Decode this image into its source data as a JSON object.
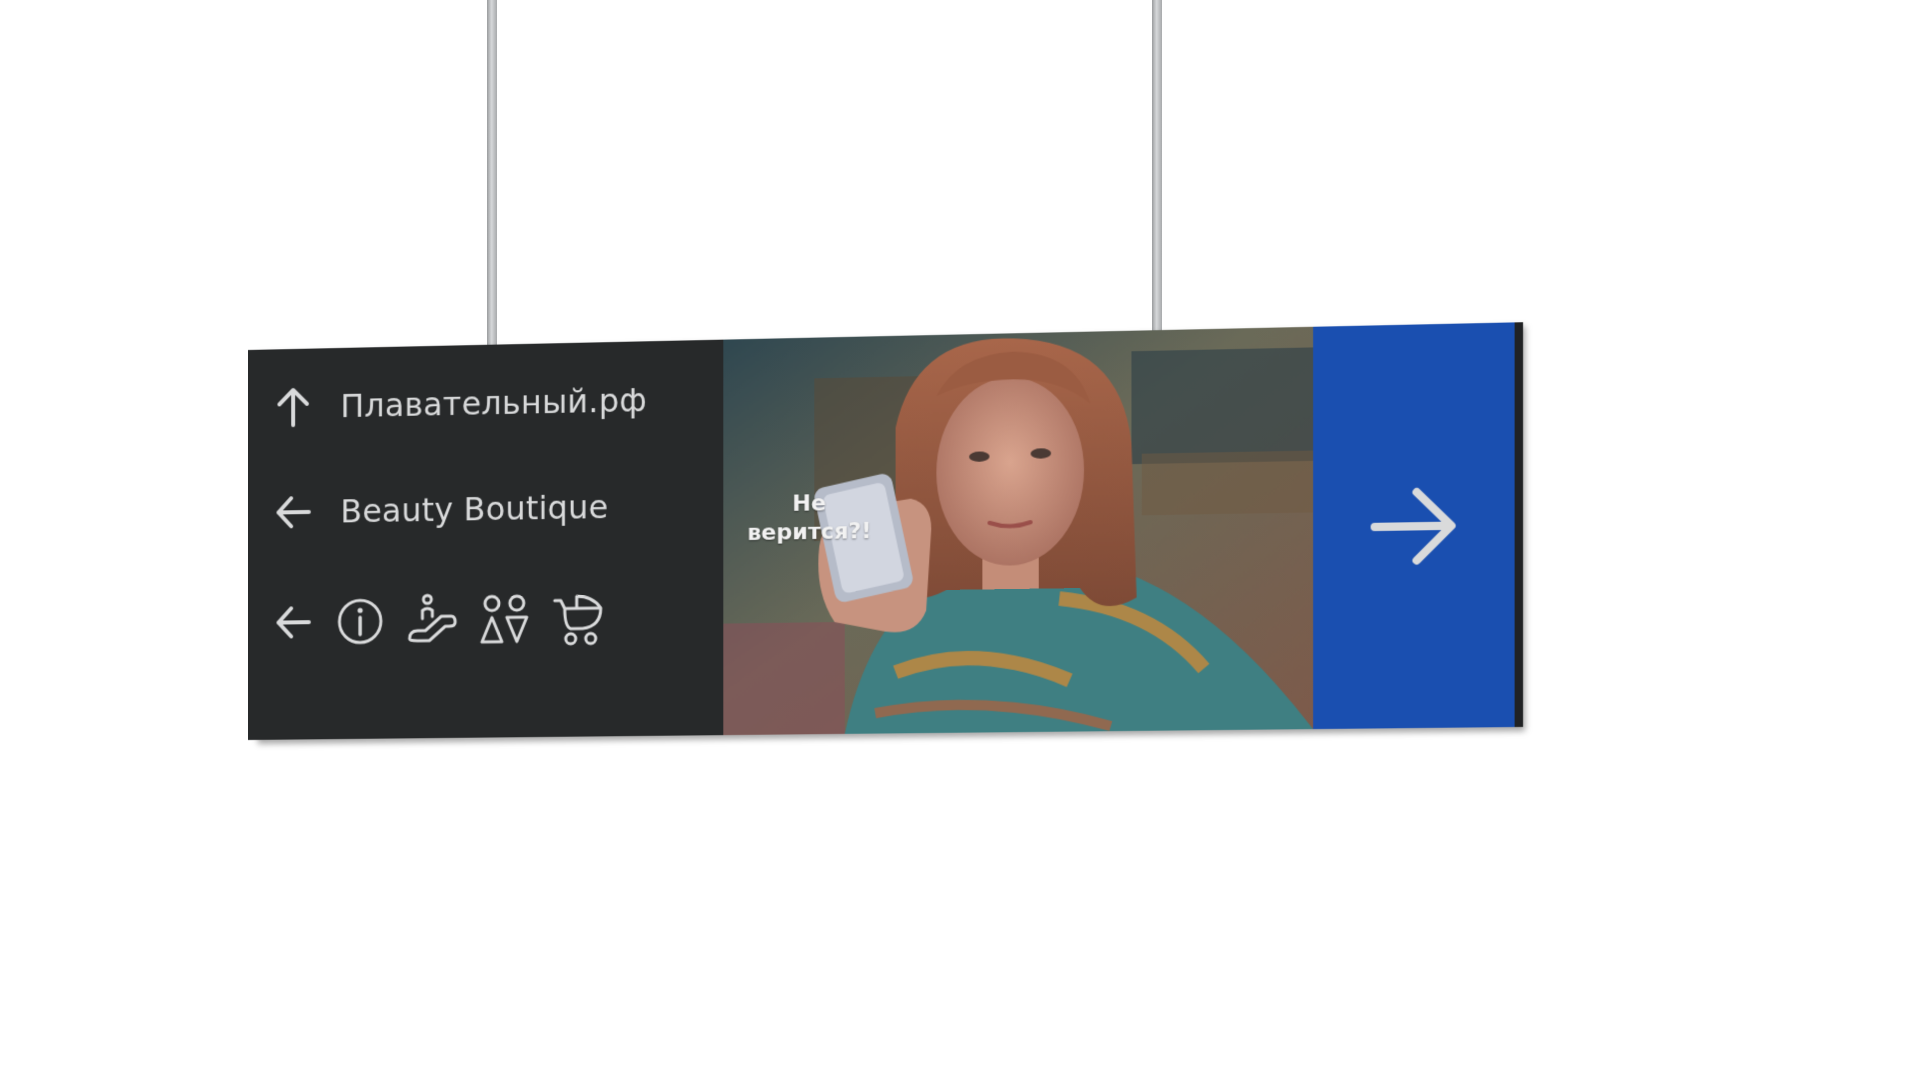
{
  "sign": {
    "rows": [
      {
        "direction": "up",
        "label": "Плавательный.рф"
      },
      {
        "direction": "left",
        "label": "Beauty Boutique"
      },
      {
        "direction": "left",
        "pictograms": [
          "info-icon",
          "escalator-icon",
          "restroom-icon",
          "baby-stroller-icon"
        ]
      }
    ],
    "ad_caption": [
      "Не",
      "верится?!"
    ],
    "right_panel": {
      "direction": "right"
    },
    "colors": {
      "left_panel": "#27292a",
      "right_panel": "#1a4fb0",
      "text": "#d9dadb"
    }
  }
}
